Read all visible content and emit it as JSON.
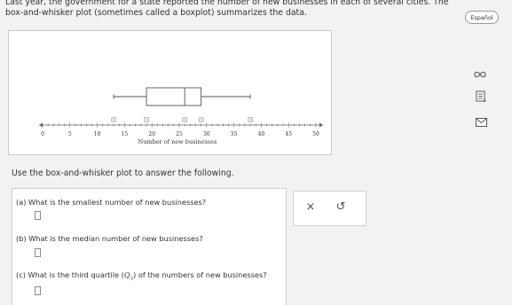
{
  "intro_text": "Last year, the government for a state reported the number of new businesses in each of several cities. The box-and-whisker plot (sometimes called a boxplot) summarizes the data.",
  "language_button": "Español",
  "chart_data": {
    "type": "boxplot",
    "title": "",
    "xlabel": "Number of new businesses",
    "ylabel": "",
    "xlim": [
      0,
      50
    ],
    "tick_labels": [
      "0",
      "5",
      "10",
      "15",
      "20",
      "25",
      "30",
      "35",
      "40",
      "45",
      "50"
    ],
    "minor_tick_step": 1,
    "min": 13,
    "q1": 19,
    "median": 26,
    "q3": 29,
    "max": 38
  },
  "icons": [
    "infinity-icon",
    "data-table-icon",
    "envelope-icon"
  ],
  "instructions": "Use the box-and-whisker plot to answer the following.",
  "questions": {
    "a": "(a) What is the smallest number of new businesses?",
    "b": "(b) What is the median number of new businesses?",
    "c_before": "(c) What is the third quartile (",
    "c_symbol": "Q",
    "c_sub": "3",
    "c_after": ") of the numbers of new businesses?"
  },
  "tools": {
    "clear": "×",
    "undo": "↺"
  }
}
